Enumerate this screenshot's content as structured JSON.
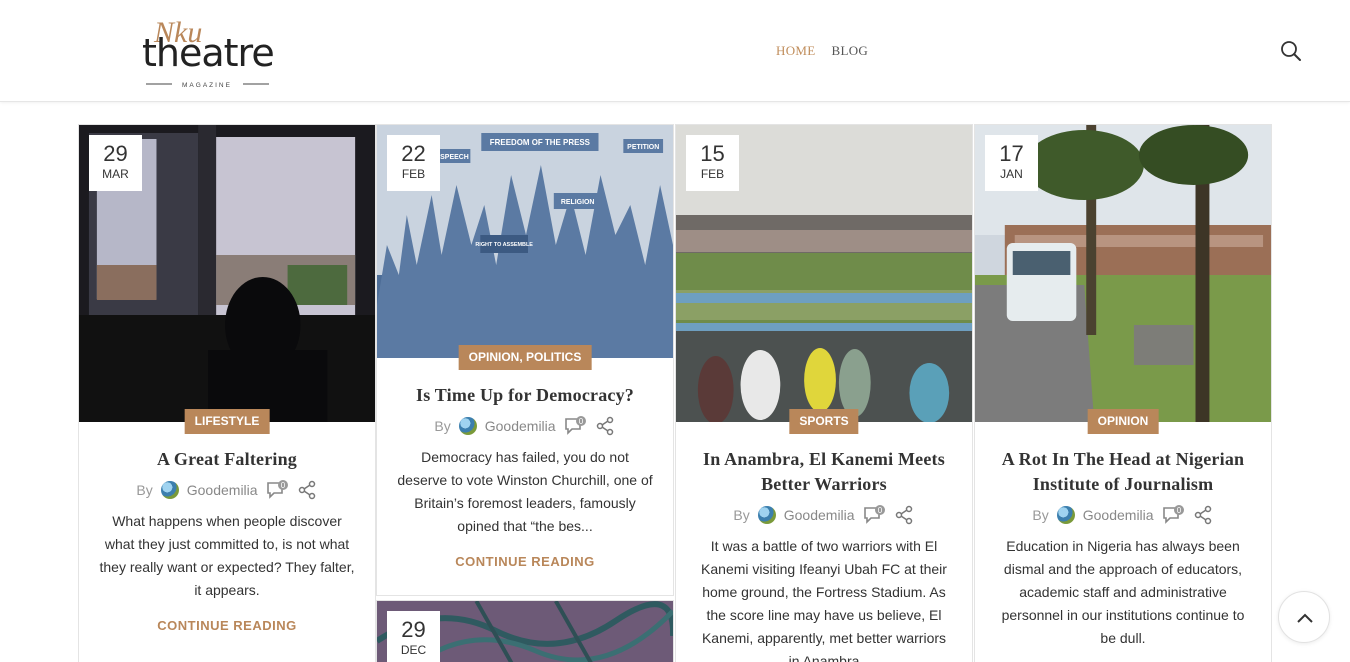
{
  "brand": {
    "script": "Nku",
    "name": "theatre",
    "tagline": "MAGAZINE"
  },
  "nav": {
    "home": "HOME",
    "blog": "BLOG"
  },
  "icons": {
    "search": "search-icon",
    "comments": "comment-icon",
    "share": "share-icon",
    "back_to_top": "chevron-up-icon"
  },
  "colors": {
    "accent": "#b9875a",
    "nav_active": "#c08d5b"
  },
  "posts": [
    {
      "day": "29",
      "month": "MAR",
      "category": "LIFESTYLE",
      "title": "A Great Faltering",
      "by": "By",
      "author": "Goodemilia",
      "comments": "0",
      "excerpt": "What happens when people discover what they just committed to, is not what they really want or expected? They falter, it appears.",
      "more": "CONTINUE READING"
    },
    {
      "day": "22",
      "month": "FEB",
      "category": "OPINION, POLITICS",
      "title": "Is Time Up for Democracy?",
      "by": "By",
      "author": "Goodemilia",
      "comments": "0",
      "excerpt": "Democracy has failed, you do not deserve to vote Winston Churchill, one of Britain’s foremost leaders, famously opined that “the bes...",
      "more": "CONTINUE READING",
      "image_text": {
        "freedom": "FREEDOM OF THE PRESS",
        "speech": "SPEECH",
        "petition": "PETITION",
        "religion": "RELIGION",
        "assemble": "RIGHT TO ASSEMBLE"
      }
    },
    {
      "day": "15",
      "month": "FEB",
      "category": "SPORTS",
      "title": "In Anambra, El Kanemi Meets Better Warriors",
      "by": "By",
      "author": "Goodemilia",
      "comments": "0",
      "excerpt": "It was a battle of two warriors with El Kanemi visiting Ifeanyi Ubah FC at their home ground, the Fortress Stadium. As the score line may have us believe, El Kanemi, apparently, met better warriors in Anambra"
    },
    {
      "day": "17",
      "month": "JAN",
      "category": "OPINION",
      "title": "A Rot In The Head at Nigerian Institute of Journalism",
      "by": "By",
      "author": "Goodemilia",
      "comments": "0",
      "excerpt": "Education in Nigeria has always been dismal and the approach of educators, academic staff and administrative personnel in our institutions continue to be dull."
    },
    {
      "day": "29",
      "month": "DEC"
    }
  ]
}
